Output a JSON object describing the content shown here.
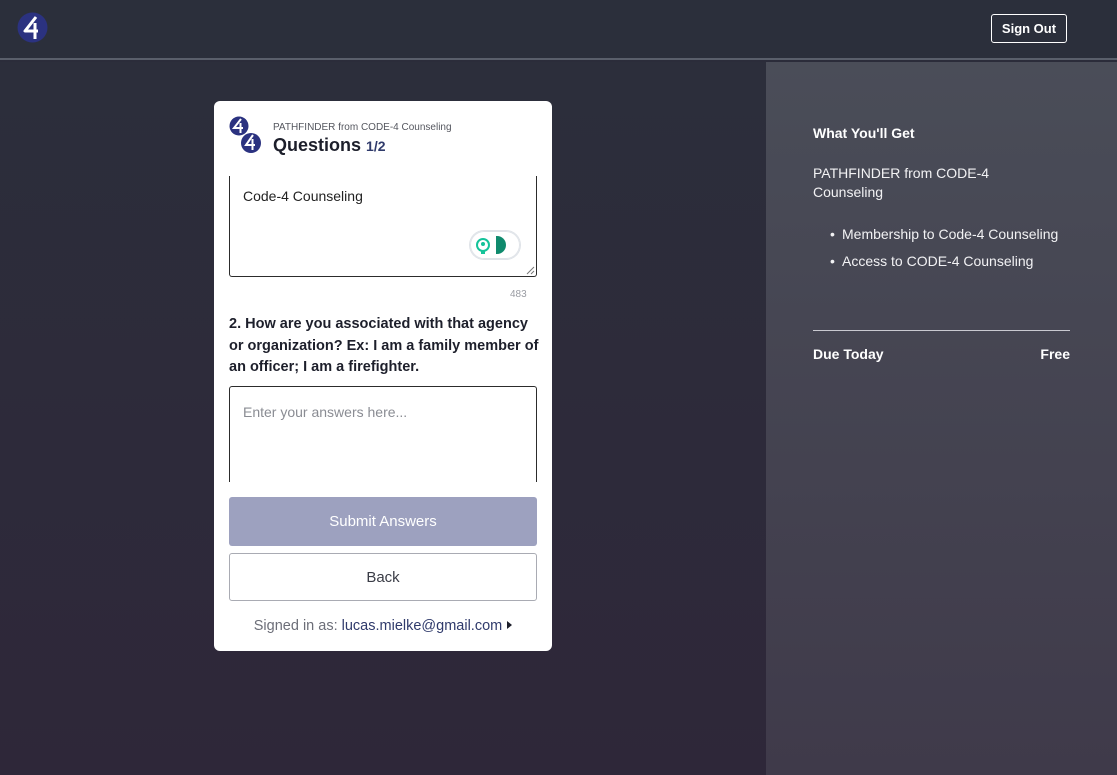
{
  "header": {
    "logo_icon": "code4-logo-icon",
    "signout_label": "Sign Out"
  },
  "card": {
    "subtitle": "PATHFINDER from CODE-4 Counseling",
    "title": "Questions",
    "progress": "1/2",
    "answer1_value": "Code-4 Counseling",
    "char_count": "483",
    "question2": "2. How are you associated with that agency or organization? Ex: I am a family member of an officer; I am a firefighter.",
    "answer2_placeholder": "Enter your answers here...",
    "submit_label": "Submit Answers",
    "back_label": "Back",
    "signed_in_prefix": "Signed in as:",
    "signed_in_email": "lucas.mielke@gmail.com"
  },
  "summary": {
    "heading": "What You'll Get",
    "product": "PATHFINDER from CODE-4 Counseling",
    "items": [
      "Membership to Code-4 Counseling",
      "Access to CODE-4 Counseling"
    ],
    "due_label": "Due Today",
    "due_value": "Free"
  },
  "colors": {
    "accent": "#2f3a6b",
    "submit_disabled": "#9da1bf",
    "grammar_green": "#15c39a"
  }
}
